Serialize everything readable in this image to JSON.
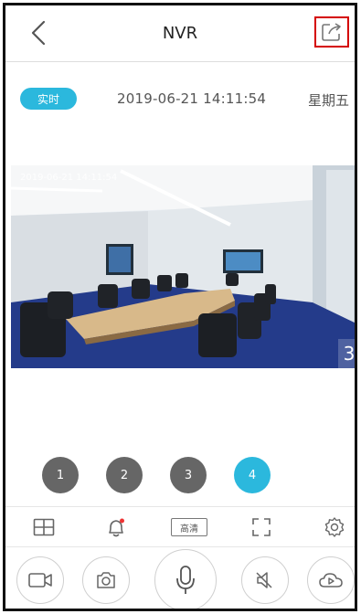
{
  "header": {
    "title": "NVR"
  },
  "info": {
    "live_label": "实时",
    "datetime": "2019-06-21 14:11:54",
    "weekday": "星期五"
  },
  "video": {
    "camera_number": "3",
    "overlay_time": "2019-06-21 14:11:54"
  },
  "channels": [
    {
      "label": "1",
      "active": false
    },
    {
      "label": "2",
      "active": false
    },
    {
      "label": "3",
      "active": false
    },
    {
      "label": "4",
      "active": true
    }
  ],
  "toolbar": {
    "quality_label": "高清"
  },
  "colors": {
    "accent": "#2bb8dd",
    "inactive_channel": "#666666",
    "highlight_border": "#d40000"
  }
}
